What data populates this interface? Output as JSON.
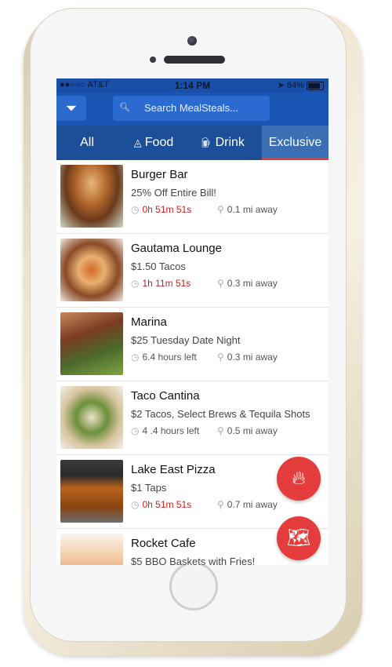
{
  "status": {
    "carrier": "●●○○○ AT&T",
    "time": "1:14 PM",
    "battery": "84%"
  },
  "header": {
    "search_placeholder": "Search MealSteals..."
  },
  "tabs": [
    {
      "label": "All"
    },
    {
      "label": "Food"
    },
    {
      "label": "Drink"
    },
    {
      "label": "Exclusive",
      "active": true
    }
  ],
  "deals": [
    {
      "name": "Burger Bar",
      "deal": "25% Off Entire Bill!",
      "time": "0h 51m 51s",
      "time_is_countdown": true,
      "distance": "0.1 mi away",
      "image": "burger"
    },
    {
      "name": "Gautama Lounge",
      "deal": "$1.50 Tacos",
      "time": "1h 11m 51s",
      "time_is_countdown": true,
      "distance": "0.3 mi away",
      "image": "tacos"
    },
    {
      "name": "Marina",
      "deal": "$25 Tuesday Date Night",
      "time": "6.4 hours left",
      "time_is_countdown": false,
      "distance": "0.3 mi away",
      "image": "steak"
    },
    {
      "name": "Taco Cantina",
      "deal": "$2 Tacos, Select Brews & Tequila Shots",
      "time": "4 .4 hours left",
      "time_is_countdown": false,
      "distance": "0.5 mi away",
      "image": "taco2"
    },
    {
      "name": "Lake East Pizza",
      "deal": "$1 Taps",
      "time": "0h 51m 51s",
      "time_is_countdown": true,
      "distance": "0.7 mi away",
      "image": "beer"
    },
    {
      "name": "Rocket Cafe",
      "deal": "$5 BBQ Baskets with Fries!",
      "image": "cocktail"
    }
  ],
  "colors": {
    "header_blue": "#1a57b5",
    "tabs_blue": "#1c4f97",
    "accent_red": "#e53935",
    "countdown_red": "#d01c1c"
  },
  "icons": {
    "filter": "filter-icon",
    "hot": "flame-icon",
    "map": "map-icon"
  }
}
